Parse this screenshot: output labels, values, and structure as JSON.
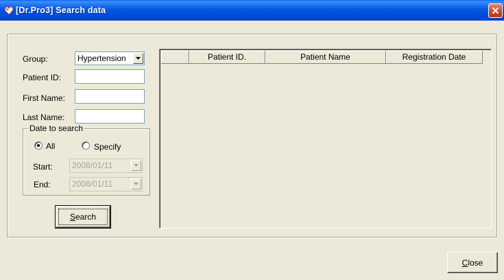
{
  "window": {
    "title": "[Dr.Pro3] Search data",
    "icon": "heart-icon"
  },
  "form": {
    "group_label": "Group:",
    "group_value": "Hypertension",
    "patient_id_label": "Patient ID:",
    "patient_id_value": "",
    "first_name_label": "First Name:",
    "first_name_value": "",
    "last_name_label": "Last Name:",
    "last_name_value": ""
  },
  "date_search": {
    "legend": "Date to search",
    "option_all": "All",
    "option_specify": "Specify",
    "selected": "All",
    "start_label": "Start:",
    "start_value": "2008/01/11",
    "end_label": "End:",
    "end_value": "2008/01/11"
  },
  "buttons": {
    "search_mnemonic": "S",
    "search_rest": "earch",
    "close_mnemonic": "C",
    "close_rest": "lose"
  },
  "results": {
    "columns": [
      "",
      "Patient ID.",
      "Patient Name",
      "Registration Date"
    ],
    "rows": []
  }
}
